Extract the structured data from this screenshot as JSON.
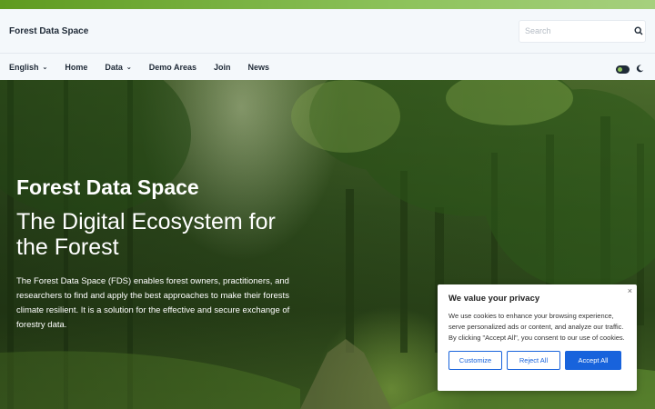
{
  "site": {
    "title": "Forest Data Space"
  },
  "search": {
    "placeholder": "Search",
    "icon": "search-icon"
  },
  "nav": {
    "items": [
      {
        "label": "English",
        "dropdown": true
      },
      {
        "label": "Home"
      },
      {
        "label": "Data",
        "dropdown": true
      },
      {
        "label": "Demo Areas"
      },
      {
        "label": "Join"
      },
      {
        "label": "News"
      }
    ],
    "caret": "⌄",
    "theme_icon": "moon-icon"
  },
  "hero": {
    "title": "Forest Data Space",
    "subtitle": "The Digital Ecosystem for the Forest",
    "description": "The Forest Data Space (FDS) enables forest owners, practitioners, and researchers to find and apply the best approaches to make their forests climate resilient. It is a solution for the effective and secure exchange of forestry data."
  },
  "cookie": {
    "title": "We value your privacy",
    "text": "We use cookies to enhance your browsing experience, serve personalized ads or content, and analyze our traffic. By clicking \"Accept All\", you consent to our use of cookies.",
    "close": "×",
    "customize": "Customize",
    "reject": "Reject All",
    "accept": "Accept All"
  },
  "colors": {
    "accent": "#8cc25a",
    "button": "#1863dc",
    "text": "#1f2a37"
  }
}
